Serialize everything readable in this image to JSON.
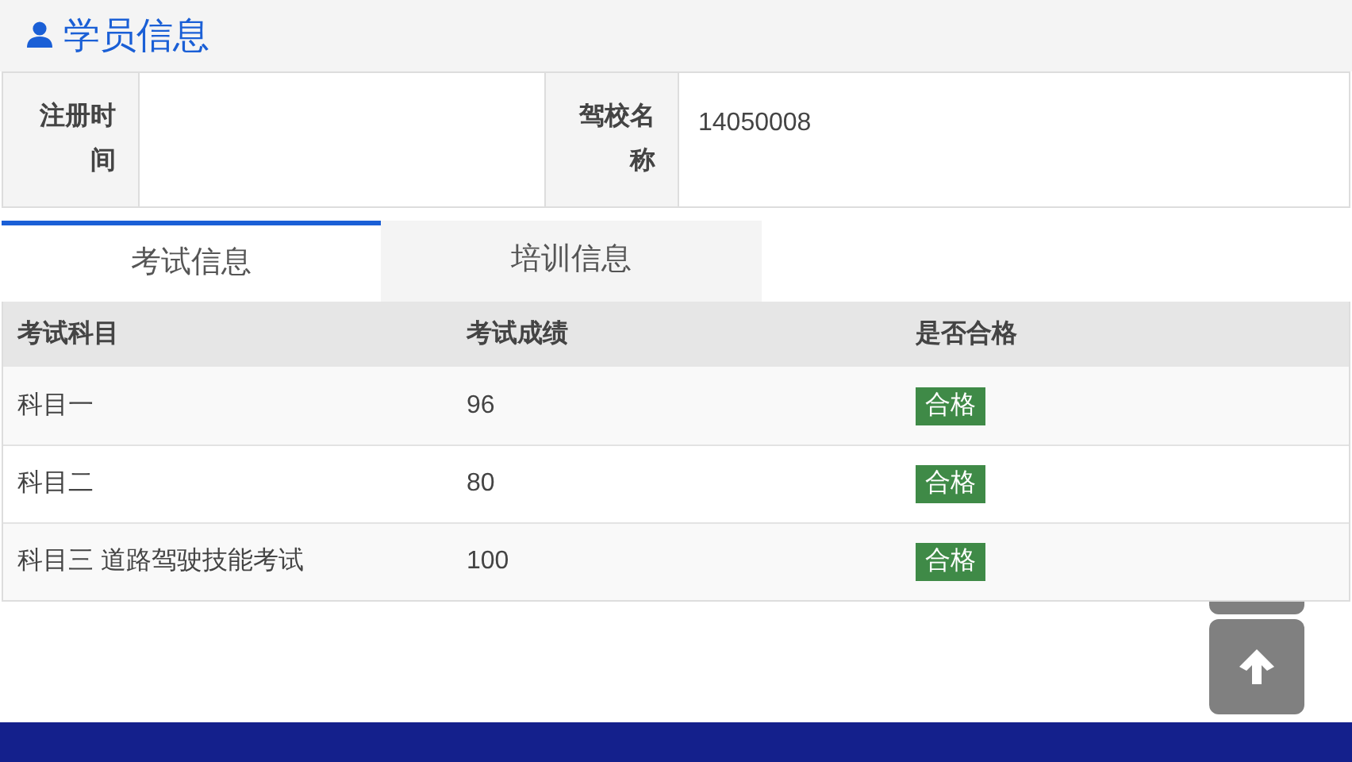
{
  "title": "学员信息",
  "info": [
    {
      "label": "注册时间"
    },
    {
      "label": "驾校名称",
      "value": "14050008"
    }
  ],
  "tabs": [
    {
      "label": "考试信息",
      "selected": true
    },
    {
      "label": "培训信息",
      "selected": false
    }
  ],
  "table": {
    "columns": [
      "考试科目",
      "考试成绩",
      "是否合格"
    ],
    "rows": [
      {
        "subject": "科目一",
        "score": "96",
        "result": "合格",
        "passed": true
      },
      {
        "subject": "科目二",
        "score": "80",
        "result": "合格",
        "passed": true
      },
      {
        "subject": "科目三 道路驾驶技能考试",
        "score": "100",
        "result": "合格",
        "passed": true
      }
    ]
  }
}
